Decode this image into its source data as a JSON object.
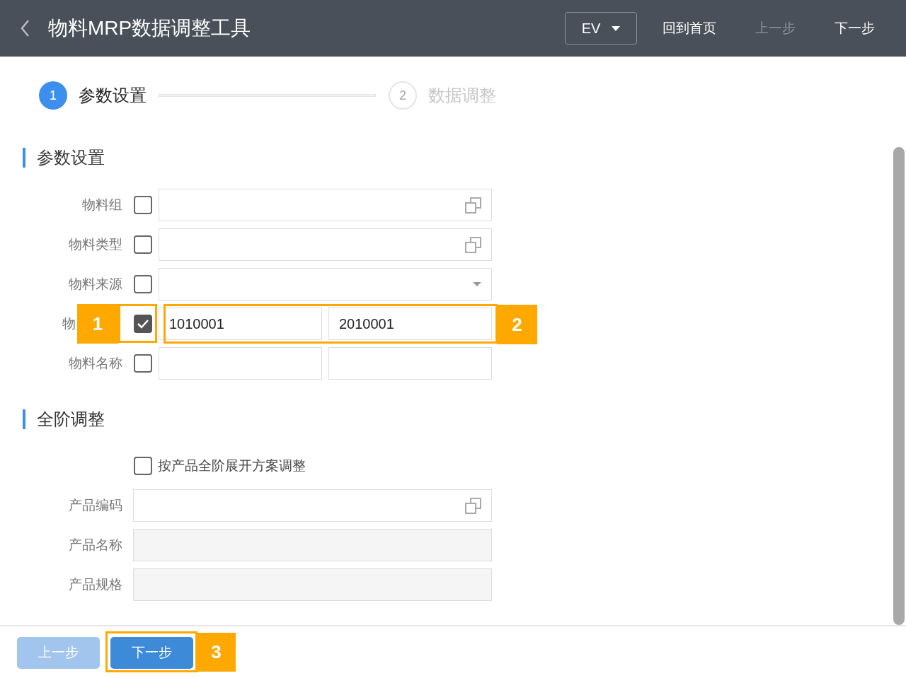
{
  "header": {
    "title": "物料MRP数据调整工具",
    "dropdown": "EV",
    "links": [
      {
        "label": "回到首页",
        "disabled": false
      },
      {
        "label": "上一步",
        "disabled": true
      },
      {
        "label": "下一步",
        "disabled": false
      }
    ]
  },
  "steps": [
    {
      "number": "1",
      "label": "参数设置",
      "selected": true
    },
    {
      "number": "2",
      "label": "数据调整",
      "selected": false
    }
  ],
  "sections": [
    {
      "title": "参数设置",
      "rows": [
        {
          "kind": "lookup",
          "label": "物料组",
          "checked": false
        },
        {
          "kind": "lookup",
          "label": "物料类型",
          "checked": false
        },
        {
          "kind": "select",
          "label": "物料来源",
          "checked": false
        },
        {
          "kind": "range",
          "label": "物",
          "cut": true,
          "checked": true,
          "from": "1010001",
          "to": "2010001"
        },
        {
          "kind": "range",
          "label": "物料名称",
          "checked": false
        }
      ]
    },
    {
      "title": "全阶调整",
      "rows": [
        {
          "kind": "option",
          "label": "按产品全阶展开方案调整",
          "checked": false
        },
        {
          "kind": "lookup",
          "label": "产品编码"
        },
        {
          "kind": "text",
          "label": "产品名称",
          "disabled": true
        },
        {
          "kind": "text",
          "label": "产品规格",
          "disabled": true
        }
      ]
    }
  ],
  "footer": {
    "buttons": [
      {
        "label": "上一步",
        "disabled": true
      },
      {
        "label": "下一步",
        "disabled": false
      }
    ]
  },
  "annotations": [
    {
      "label": "1"
    },
    {
      "label": "2"
    },
    {
      "label": "3"
    }
  ]
}
